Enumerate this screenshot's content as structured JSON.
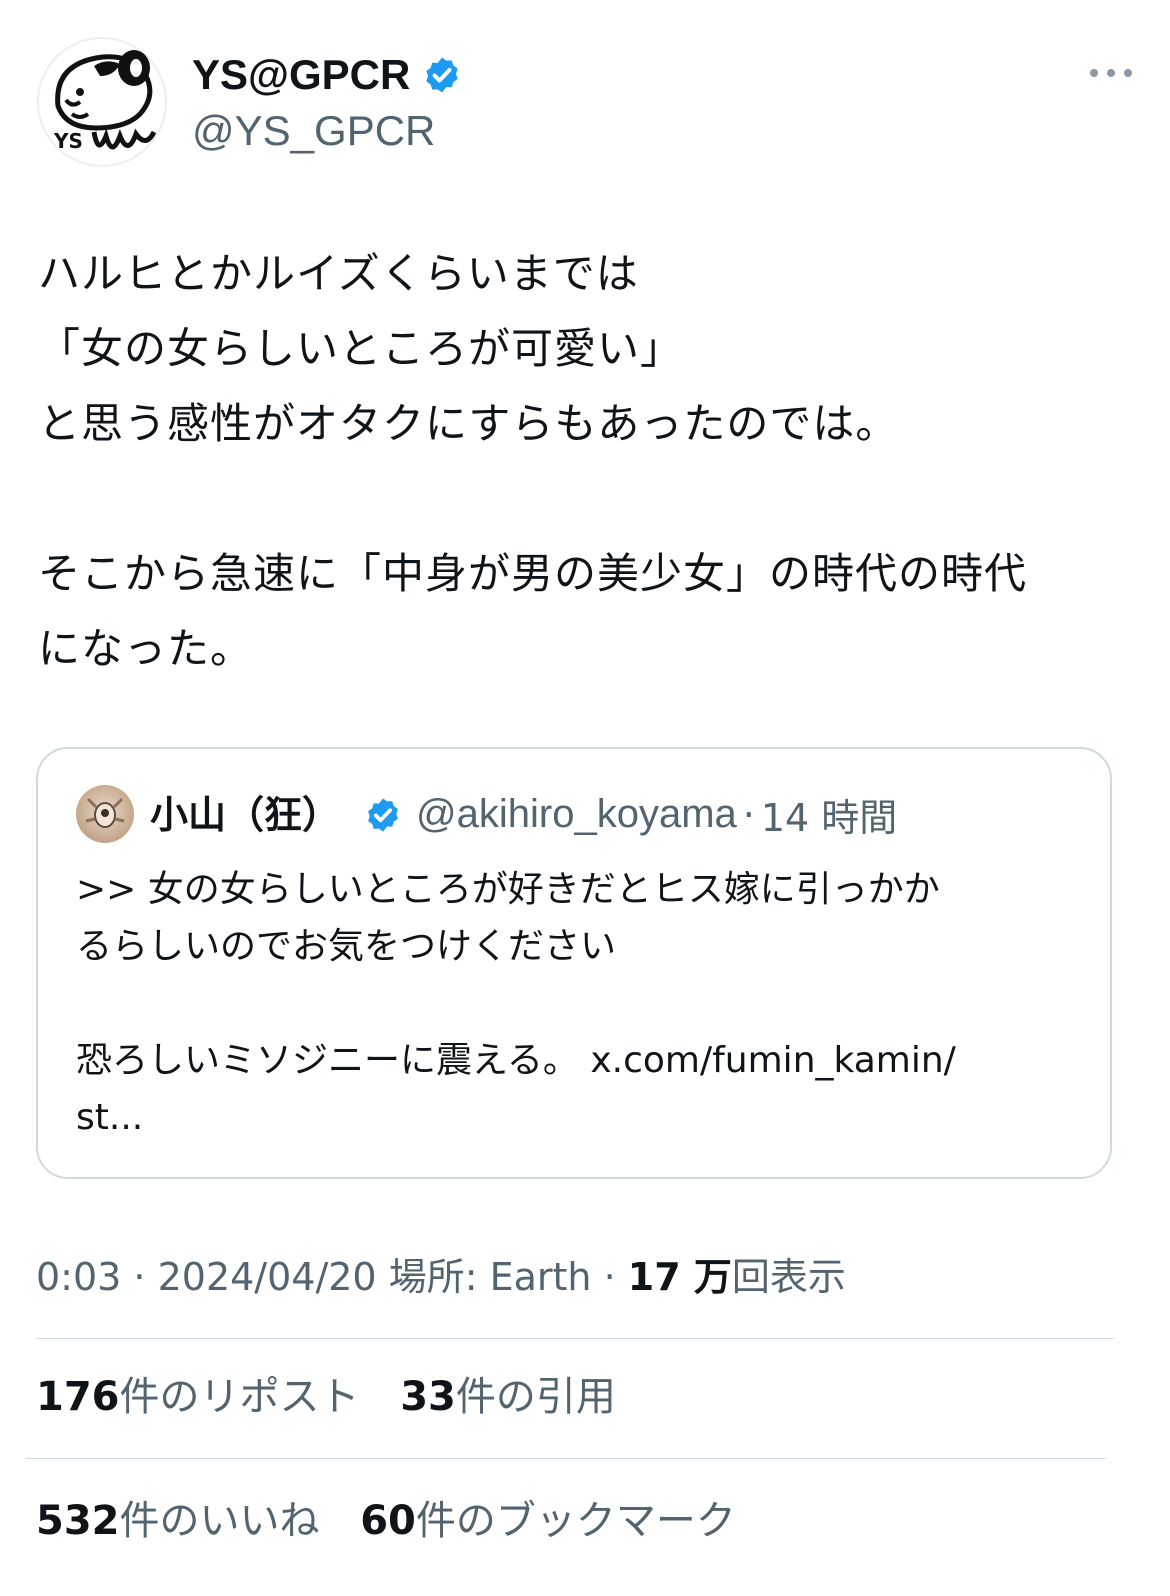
{
  "author": {
    "display_name": "YS@GPCR",
    "handle": "@YS_GPCR",
    "verified_icon": "verified-badge-icon",
    "avatar_text": "YS"
  },
  "tweet": {
    "text": "ハルヒとかルイズくらいまでは\n「女の女らしいところが可愛い」\nと思う感性がオタクにすらもあったのでは。\n\nそこから急速に「中身が男の美少女」の時代の時代\nになった。"
  },
  "quote": {
    "name": "小山（狂）",
    "handle": "@akihiro_koyama",
    "separator": "·",
    "time": "14 時間",
    "text": ">> 女の女らしいところが好きだとヒス嫁に引っかか\nるらしいのでお気をつけください\n\n恐ろしいミソジニーに震える。 x.com/fumin_kamin/\nst..."
  },
  "meta": {
    "time": "0:03",
    "sep1": " · ",
    "date": "2024/04/20",
    "location": " 場所: Earth",
    "sep2": " · ",
    "views_count": "17 万",
    "views_label": "回表示"
  },
  "stats": {
    "reposts_count": "176",
    "reposts_label": "件のリポスト",
    "quotes_count": "33",
    "quotes_label": "件の引用",
    "likes_count": "532",
    "likes_label": "件のいいね",
    "bookmarks_count": "60",
    "bookmarks_label": "件のブックマーク"
  },
  "colors": {
    "verified_blue": "#1d9bf0",
    "secondary_text": "#536471",
    "border": "#cfd9de"
  }
}
